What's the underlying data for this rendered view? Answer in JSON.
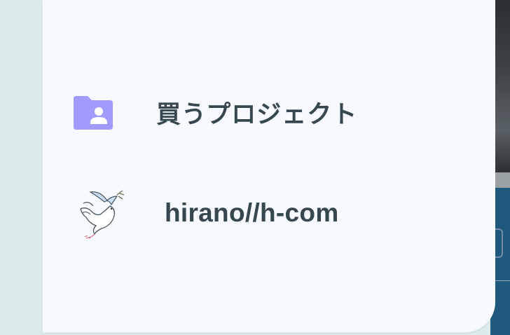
{
  "menu": {
    "items": [
      {
        "label": "買うプロジェクト",
        "icon": "folder-person-icon"
      },
      {
        "label": "hirano//h-com",
        "icon": "dove-avatar-icon"
      }
    ]
  },
  "colors": {
    "panel_background": "#f6f9fe",
    "label_text": "#37474f",
    "folder_icon": "#a29bfe",
    "backdrop_teal": "#dbeaea",
    "backdrop_navy": "#1f5a7e"
  }
}
